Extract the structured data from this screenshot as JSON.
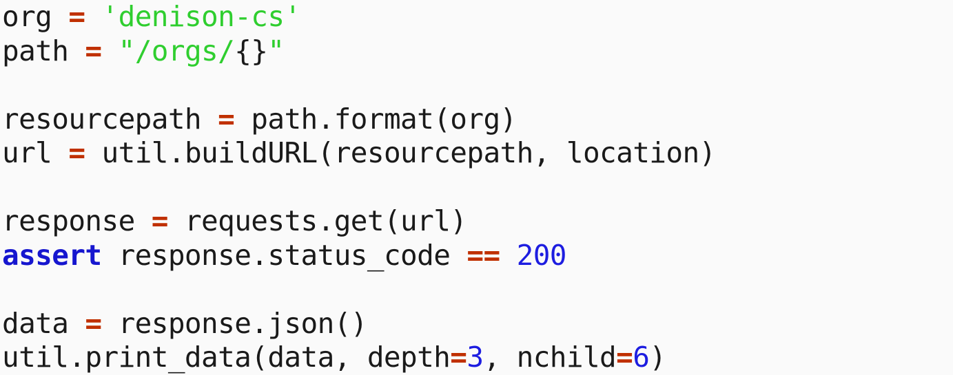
{
  "listing": {
    "language": "python",
    "background_color": "#fafafa",
    "colors": {
      "plain": "#1a1a1a",
      "operator": "#c03000",
      "string": "#2fce2f",
      "keyword": "#1616cf",
      "number": "#1d1de0"
    },
    "lines": [
      {
        "index": 1,
        "text": "org = 'denison-cs'",
        "tokens": [
          {
            "t": "org ",
            "k": "plain"
          },
          {
            "t": "=",
            "k": "op"
          },
          {
            "t": " ",
            "k": "plain"
          },
          {
            "t": "'denison-cs'",
            "k": "string"
          }
        ]
      },
      {
        "index": 2,
        "text": "path = \"/orgs/{}\"",
        "tokens": [
          {
            "t": "path ",
            "k": "plain"
          },
          {
            "t": "=",
            "k": "op"
          },
          {
            "t": " ",
            "k": "plain"
          },
          {
            "t": "\"/orgs/",
            "k": "string"
          },
          {
            "t": "{}",
            "k": "brace"
          },
          {
            "t": "\"",
            "k": "string"
          }
        ]
      },
      {
        "index": 3,
        "text": "",
        "tokens": []
      },
      {
        "index": 4,
        "text": "resourcepath = path.format(org)",
        "tokens": [
          {
            "t": "resourcepath ",
            "k": "plain"
          },
          {
            "t": "=",
            "k": "op"
          },
          {
            "t": " path.format(org)",
            "k": "plain"
          }
        ]
      },
      {
        "index": 5,
        "text": "url = util.buildURL(resourcepath, location)",
        "tokens": [
          {
            "t": "url ",
            "k": "plain"
          },
          {
            "t": "=",
            "k": "op"
          },
          {
            "t": " util.buildURL(resourcepath, location)",
            "k": "plain"
          }
        ]
      },
      {
        "index": 6,
        "text": "",
        "tokens": []
      },
      {
        "index": 7,
        "text": "response = requests.get(url)",
        "tokens": [
          {
            "t": "response ",
            "k": "plain"
          },
          {
            "t": "=",
            "k": "op"
          },
          {
            "t": " requests.get(url)",
            "k": "plain"
          }
        ]
      },
      {
        "index": 8,
        "text": "assert response.status_code == 200",
        "tokens": [
          {
            "t": "assert",
            "k": "keyword"
          },
          {
            "t": " response.status_code ",
            "k": "plain"
          },
          {
            "t": "==",
            "k": "op"
          },
          {
            "t": " ",
            "k": "plain"
          },
          {
            "t": "200",
            "k": "number"
          }
        ]
      },
      {
        "index": 9,
        "text": "",
        "tokens": []
      },
      {
        "index": 10,
        "text": "data = response.json()",
        "tokens": [
          {
            "t": "data ",
            "k": "plain"
          },
          {
            "t": "=",
            "k": "op"
          },
          {
            "t": " response.json()",
            "k": "plain"
          }
        ]
      },
      {
        "index": 11,
        "text": "util.print_data(data, depth=3, nchild=6)",
        "tokens": [
          {
            "t": "util.print_data(data, depth",
            "k": "plain"
          },
          {
            "t": "=",
            "k": "op"
          },
          {
            "t": "3",
            "k": "number"
          },
          {
            "t": ", nchild",
            "k": "plain"
          },
          {
            "t": "=",
            "k": "op"
          },
          {
            "t": "6",
            "k": "number"
          },
          {
            "t": ")",
            "k": "plain"
          }
        ]
      }
    ]
  }
}
